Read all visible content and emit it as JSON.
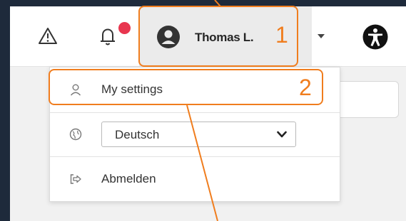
{
  "header": {
    "icons": [
      "warning-icon",
      "bell-icon",
      "avatar-icon",
      "chevron-down-icon",
      "accessibility-icon"
    ],
    "user_name": "Thomas L."
  },
  "user_menu": {
    "settings_label": "My settings",
    "language_value": "Deutsch",
    "logout_label": "Abmelden"
  },
  "annotations": {
    "callout_1": "1",
    "callout_2": "2",
    "color": "#f07d1e"
  },
  "colors": {
    "outer_bg": "#1e2a3b",
    "badge": "#e8364f"
  }
}
